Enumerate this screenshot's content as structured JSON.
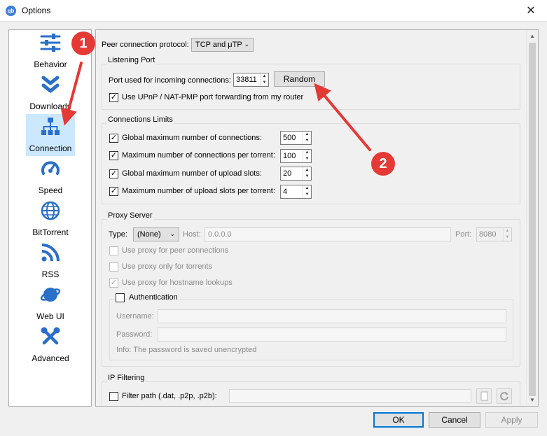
{
  "window": {
    "title": "Options",
    "app_icon": "qb",
    "close": "✕"
  },
  "sidebar": {
    "items": [
      {
        "label": "Behavior",
        "icon": "sliders-icon"
      },
      {
        "label": "Downloads",
        "icon": "double-chevron-down-icon"
      },
      {
        "label": "Connection",
        "icon": "network-icon",
        "active": true
      },
      {
        "label": "Speed",
        "icon": "speedometer-icon"
      },
      {
        "label": "BitTorrent",
        "icon": "globe-icon"
      },
      {
        "label": "RSS",
        "icon": "rss-icon"
      },
      {
        "label": "Web UI",
        "icon": "planet-icon"
      },
      {
        "label": "Advanced",
        "icon": "tools-icon"
      }
    ]
  },
  "connection": {
    "protocol_label": "Peer connection protocol:",
    "protocol_value": "TCP and μTP",
    "listening": {
      "title": "Listening Port",
      "port_label": "Port used for incoming connections:",
      "port_value": "33811",
      "random_label": "Random",
      "upnp_label": "Use UPnP / NAT-PMP port forwarding from my router",
      "upnp_checked": true
    },
    "limits": {
      "title": "Connections Limits",
      "rows": [
        {
          "label": "Global maximum number of connections:",
          "value": "500"
        },
        {
          "label": "Maximum number of connections per torrent:",
          "value": "100"
        },
        {
          "label": "Global maximum number of upload slots:",
          "value": "20"
        },
        {
          "label": "Maximum number of upload slots per torrent:",
          "value": "4"
        }
      ]
    },
    "proxy": {
      "title": "Proxy Server",
      "type_label": "Type:",
      "type_value": "(None)",
      "host_label": "Host:",
      "host_placeholder": "0.0.0.0",
      "port_label": "Port:",
      "port_value": "8080",
      "peer_label": "Use proxy for peer connections",
      "torrents_only_label": "Use proxy only for torrents",
      "hostname_label": "Use proxy for hostname lookups",
      "auth_label": "Authentication",
      "username_label": "Username:",
      "password_label": "Password:",
      "info": "Info: The password is saved unencrypted"
    },
    "ipfilter": {
      "title": "IP Filtering",
      "filter_label": "Filter path (.dat, .p2p, .p2b):"
    }
  },
  "footer": {
    "ok": "OK",
    "cancel": "Cancel",
    "apply": "Apply"
  },
  "annotations": {
    "badge1": "1",
    "badge2": "2"
  },
  "colors": {
    "accent": "#0078d7",
    "selection": "#cce8ff",
    "icon_blue": "#2a6fc8",
    "annotation_red": "#e53935"
  }
}
